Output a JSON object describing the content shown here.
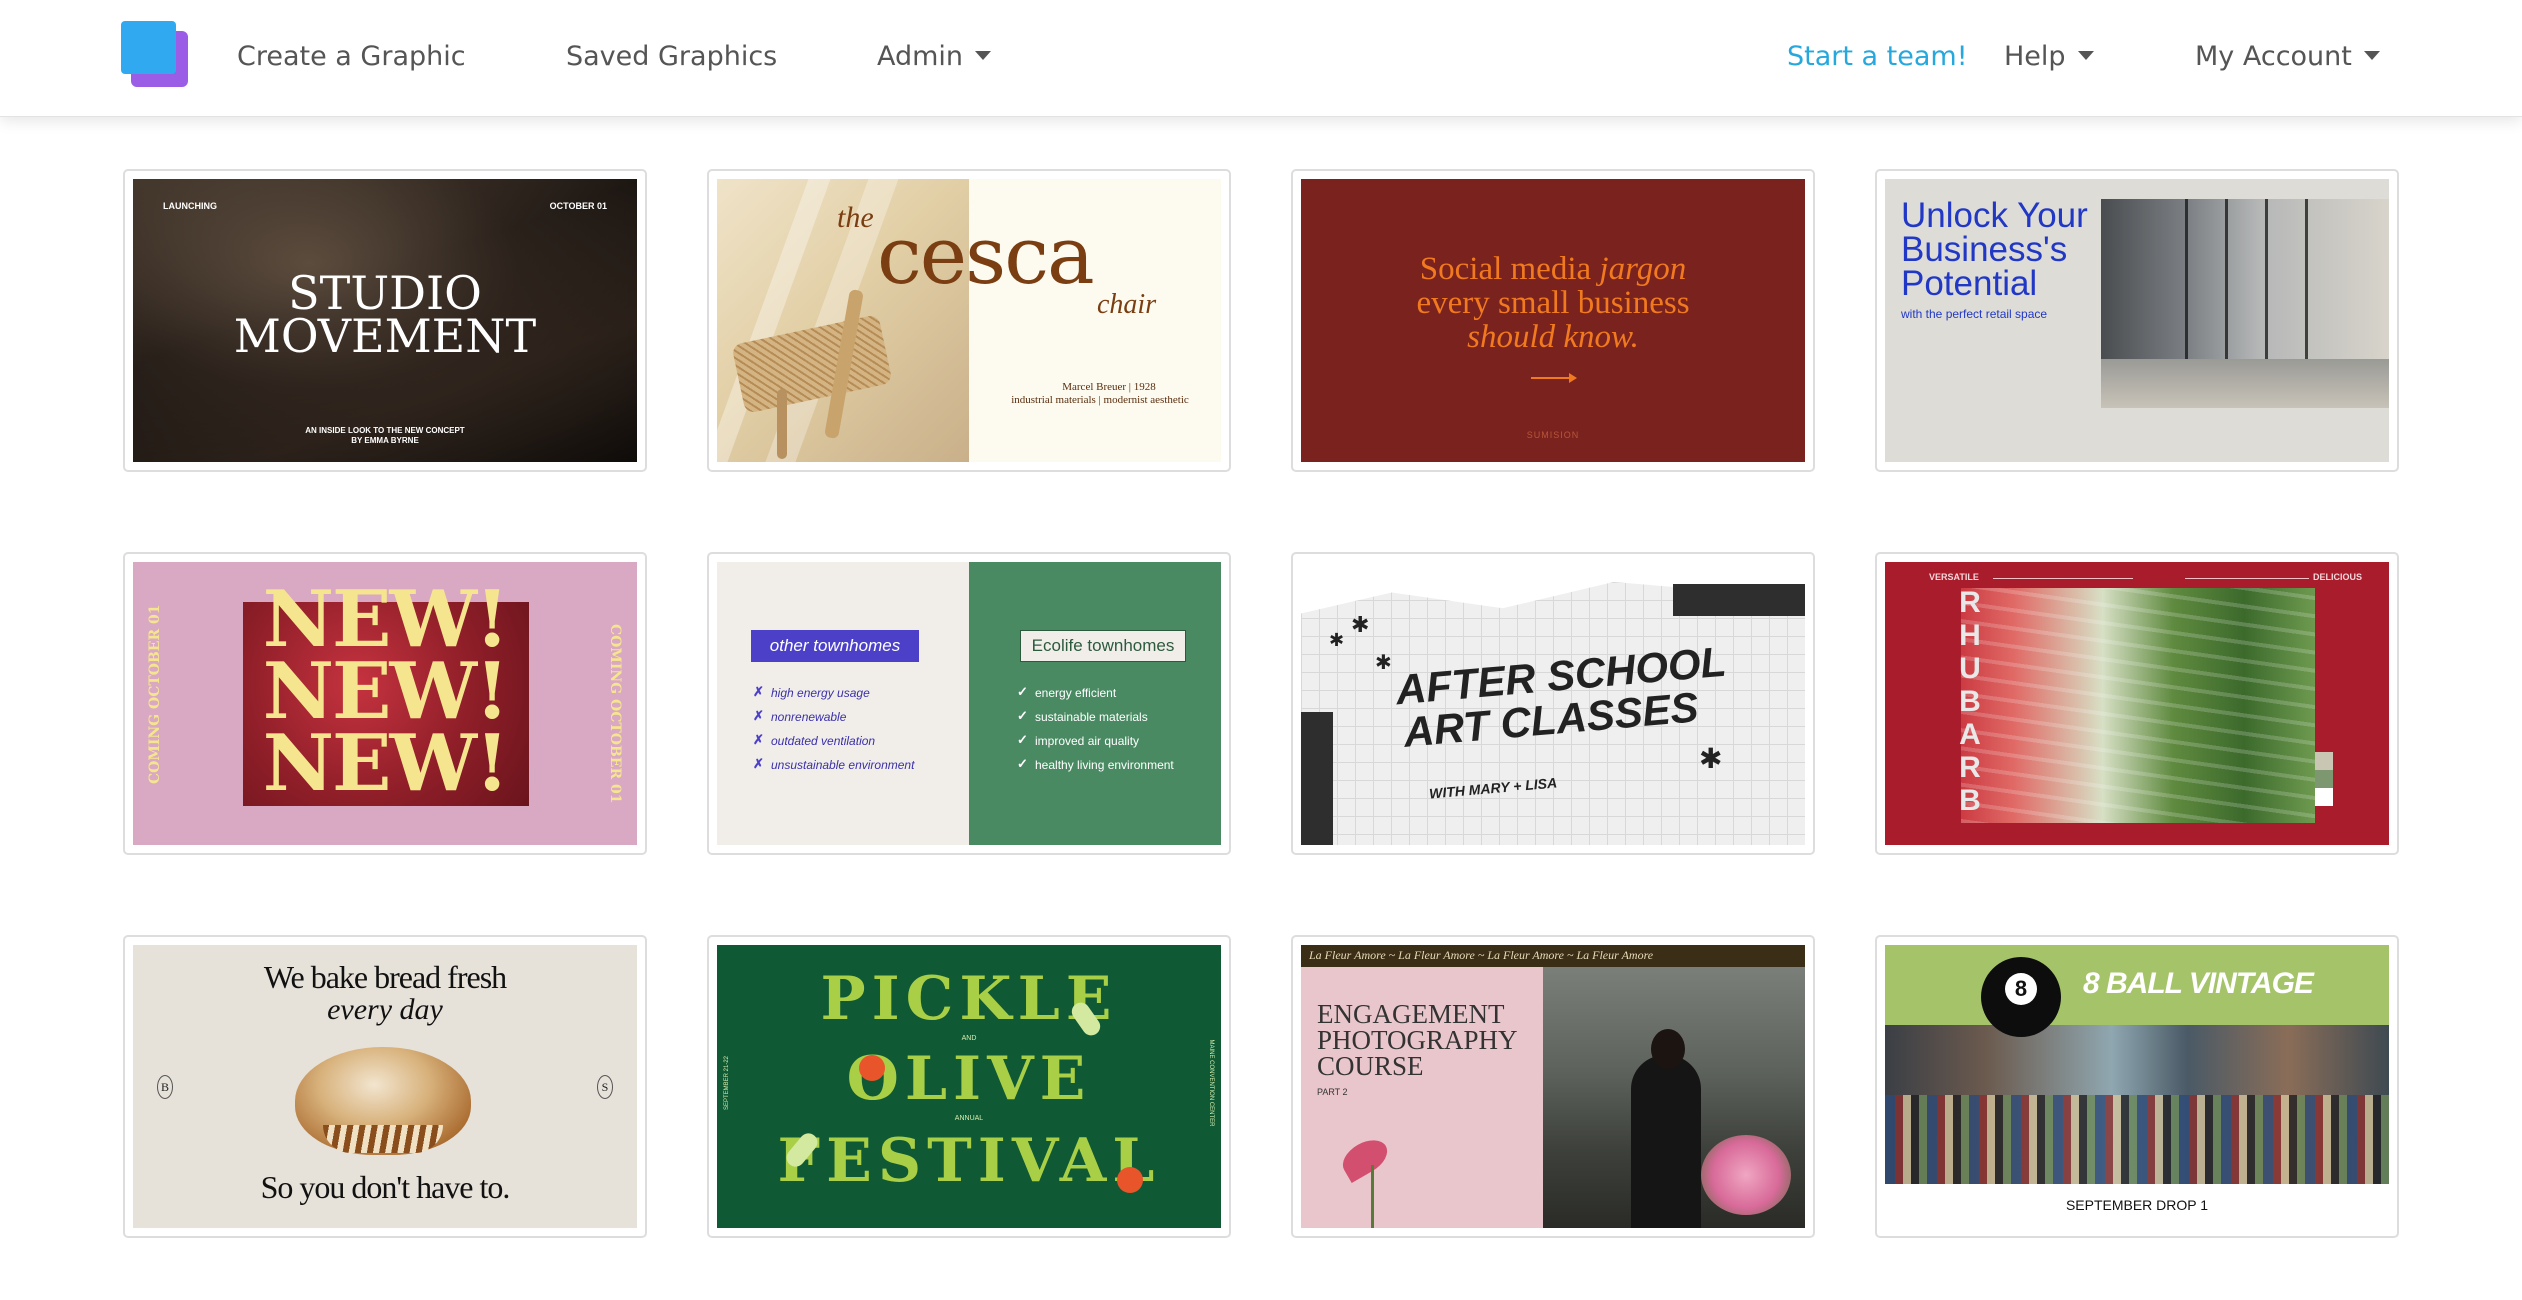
{
  "nav": {
    "create": "Create a Graphic",
    "saved": "Saved Graphics",
    "admin": "Admin",
    "team": "Start a team!",
    "help": "Help",
    "account": "My Account"
  },
  "colors": {
    "logo_front": "#31a9f0",
    "logo_back": "#9b5de5",
    "team_link": "#27a8dd"
  },
  "templates": [
    {
      "top_left": "LAUNCHING",
      "top_right": "OCTOBER 01",
      "title_1": "STUDIO",
      "title_2": "MOVEMENT",
      "sub_1": "AN INSIDE LOOK TO THE NEW CONCEPT",
      "sub_2": "BY EMMA BYRNE"
    },
    {
      "the": "the",
      "name": "cesca",
      "chair": "chair",
      "line_1": "Marcel Breuer | 1928",
      "line_2": "industrial materials | modernist aesthetic"
    },
    {
      "line_1a": "Social media ",
      "line_1b": "jargon",
      "line_2": "every small business",
      "line_3": "should know.",
      "brand": "SUMISION"
    },
    {
      "line_1": "Unlock Your",
      "line_2": "Business's",
      "line_3": "Potential",
      "sub": "with the perfect retail space"
    },
    {
      "word": "NEW!",
      "side": "COMING OCTOBER 01"
    },
    {
      "left_title": "other townhomes",
      "left_items": [
        "high energy usage",
        "nonrenewable",
        "outdated ventilation",
        "unsustainable environment"
      ],
      "right_title": "Ecolife townhomes",
      "right_items": [
        "energy efficient",
        "sustainable materials",
        "improved air quality",
        "healthy living environment"
      ]
    },
    {
      "line_1": "AFTER SCHOOL",
      "line_2": "ART CLASSES",
      "sub": "WITH MARY + LISA"
    },
    {
      "left": "VERSATILE",
      "right": "DELICIOUS",
      "letters": [
        "R",
        "H",
        "U",
        "B",
        "A",
        "R",
        "B"
      ]
    },
    {
      "line_1": "We bake bread fresh",
      "line_2": "every day",
      "line_3": "So you don't have to.",
      "left_badge": "B",
      "right_badge": "S"
    },
    {
      "pickle": "PICKLE",
      "and": "AND",
      "olive": "OLIVE",
      "annual": "ANNUAL",
      "festival": "FESTIVAL",
      "left_side": "SEPTEMBER 21-22",
      "right_side": "MAINE CONVENTION CENTER"
    },
    {
      "banner": "La Fleur Amore ~ La Fleur Amore ~ La Fleur Amore ~ La Fleur Amore",
      "line_1": "ENGAGEMENT",
      "line_2": "PHOTOGRAPHY",
      "line_3": "COURSE",
      "part": "PART 2"
    },
    {
      "ball": "8",
      "title": "8 BALL VINTAGE",
      "drop": "SEPTEMBER DROP 1"
    }
  ]
}
